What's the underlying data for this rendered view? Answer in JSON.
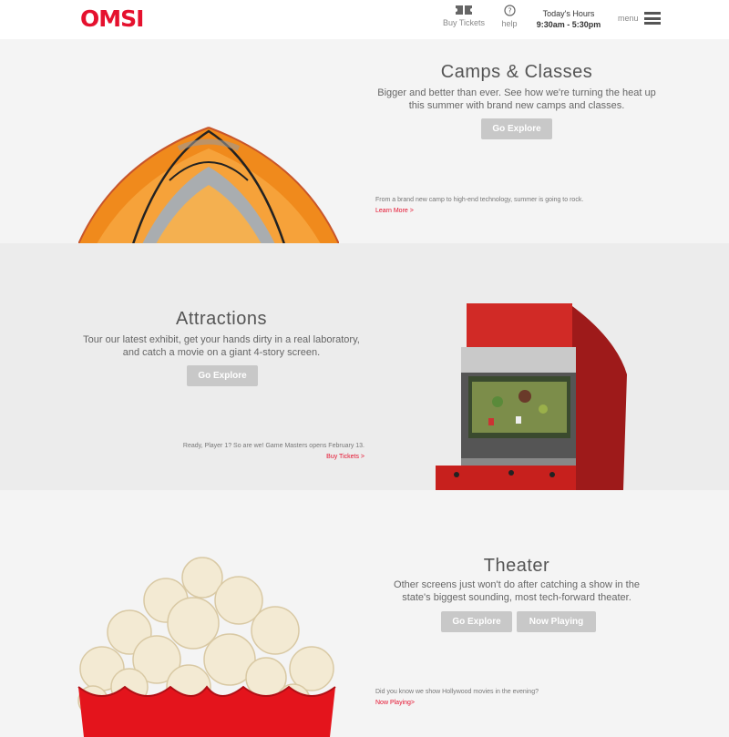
{
  "header": {
    "logo": "OMSI",
    "buy_tickets": "Buy Tickets",
    "help": "help",
    "hours_label": "Today's Hours",
    "hours_value": "9:30am - 5:30pm",
    "menu": "menu"
  },
  "camps": {
    "title": "Camps & Classes",
    "desc_line1": "Bigger and better than ever. See how we're turning the heat up",
    "desc_line2": "this summer with brand new camps and classes.",
    "button": "Go Explore",
    "note": "From a brand new camp to high-end technology, summer is going to rock.",
    "link": "Learn More >"
  },
  "attractions": {
    "title": "Attractions",
    "desc_line1": "Tour our latest exhibit, get your hands dirty in a real laboratory,",
    "desc_line2": "and catch a movie on a giant 4-story screen.",
    "button": "Go Explore",
    "note": "Ready, Player 1? So are we! Game Masters opens February 13.",
    "link": "Buy Tickets >"
  },
  "theater": {
    "title": "Theater",
    "desc_line1": "Other screens just won't do after catching a show in the",
    "desc_line2": "state's biggest sounding, most tech-forward theater.",
    "button1": "Go Explore",
    "button2": "Now Playing",
    "note": "Did you know we show Hollywood movies in the evening?",
    "link": "Now Playing>"
  },
  "colors": {
    "brand": "#e5112e",
    "button": "#c8c8c8"
  }
}
